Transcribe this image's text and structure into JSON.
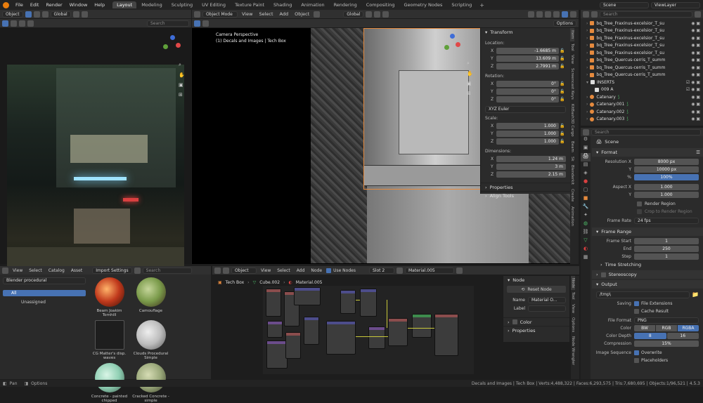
{
  "topbar": {
    "menus": [
      "File",
      "Edit",
      "Render",
      "Window",
      "Help"
    ],
    "workspaces": [
      "Layout",
      "Modeling",
      "Sculpting",
      "UV Editing",
      "Texture Paint",
      "Shading",
      "Animation",
      "Rendering",
      "Compositing",
      "Geometry Nodes",
      "Scripting"
    ],
    "scene": "Scene",
    "view_layer": "ViewLayer"
  },
  "left_viewport": {
    "mode": "Object",
    "orientation": "Global",
    "search_placeholder": "Search"
  },
  "main_viewport": {
    "mode": "Object Mode",
    "menus": [
      "View",
      "Select",
      "Add",
      "Object"
    ],
    "orientation": "Global",
    "options_label": "Options",
    "camera_label": "Camera Perspective",
    "collection_label": "(1) Decals and Images | Tech Box"
  },
  "npanel": {
    "transform_title": "Transform",
    "location_label": "Location:",
    "location": [
      {
        "axis": "X",
        "value": "-1.6685 m"
      },
      {
        "axis": "Y",
        "value": "13.609 m"
      },
      {
        "axis": "Z",
        "value": "2.7991 m"
      }
    ],
    "rotation_label": "Rotation:",
    "rotation": [
      {
        "axis": "X",
        "value": "0°"
      },
      {
        "axis": "Y",
        "value": "0°"
      },
      {
        "axis": "Z",
        "value": "0°"
      }
    ],
    "rotation_mode": "XYZ Euler",
    "scale_label": "Scale:",
    "scale": [
      {
        "axis": "X",
        "value": "1.000"
      },
      {
        "axis": "Y",
        "value": "1.000"
      },
      {
        "axis": "Z",
        "value": "1.000"
      }
    ],
    "dimensions_label": "Dimensions:",
    "dimensions": [
      {
        "axis": "X",
        "value": "1.24 m"
      },
      {
        "axis": "Y",
        "value": "3 m"
      },
      {
        "axis": "Z",
        "value": "2.15 m"
      }
    ],
    "properties_label": "Properties",
    "align_tools_label": "Align Tools",
    "tabs": [
      "Item",
      "Tool",
      "View",
      "Screencast Keys",
      "KitBash3D Cargo",
      "Beam",
      "Sk",
      "Blenderkit",
      "Create",
      "Animation"
    ]
  },
  "outliner": {
    "search_placeholder": "Search",
    "items": [
      {
        "name": "bq_Tree_Fraxinus-excelsior_T_su"
      },
      {
        "name": "bq_Tree_Fraxinus-excelsior_T_su"
      },
      {
        "name": "bq_Tree_Fraxinus-excelsior_T_su"
      },
      {
        "name": "bq_Tree_Fraxinus-excelsior_T_su"
      },
      {
        "name": "bq_Tree_Fraxinus-excelsior_T_su"
      },
      {
        "name": "bq_Tree_Quercus-cerris_T_summ"
      },
      {
        "name": "bq_Tree_Quercus-cerris_T_summ"
      },
      {
        "name": "bq_Tree_Quercus-cerris_T_summ"
      },
      {
        "name": "INSERTS"
      },
      {
        "name": "009 A"
      },
      {
        "name": "Catenary"
      },
      {
        "name": "Catenary.001"
      },
      {
        "name": "Catenary.002"
      },
      {
        "name": "Catenary.003"
      }
    ]
  },
  "properties": {
    "search_placeholder": "Search",
    "scene_name": "Scene",
    "format_label": "Format",
    "resolution_x_label": "Resolution X",
    "resolution_x": "8000 px",
    "resolution_y_label": "Y",
    "resolution_y": "10000 px",
    "percent_label": "%",
    "percent": "100%",
    "aspect_x_label": "Aspect X",
    "aspect_x": "1.000",
    "aspect_y_label": "Y",
    "aspect_y": "1.000",
    "render_region": "Render Region",
    "crop_region": "Crop to Render Region",
    "frame_rate_label": "Frame Rate",
    "frame_rate": "24 fps",
    "frame_range_label": "Frame Range",
    "frame_start_label": "Frame Start",
    "frame_start": "1",
    "end_label": "End",
    "end": "250",
    "step_label": "Step",
    "step": "1",
    "time_stretching": "Time Stretching",
    "stereoscopy": "Stereoscopy",
    "output_label": "Output",
    "output_path": "/tmp\\",
    "saving_label": "Saving",
    "file_extensions": "File Extensions",
    "cache_result": "Cache Result",
    "file_format_label": "File Format",
    "file_format": "PNG",
    "color_label": "Color",
    "color_options": [
      "BW",
      "RGB",
      "RGBA"
    ],
    "color_depth_label": "Color Depth",
    "color_depth_options": [
      "8",
      "16"
    ],
    "compression_label": "Compression",
    "compression": "15%",
    "image_sequence_label": "Image Sequence",
    "overwrite": "Overwrite",
    "placeholders": "Placeholders"
  },
  "asset_browser": {
    "menus": [
      "View",
      "Select",
      "Catalog",
      "Asset"
    ],
    "import_settings": "Import Settings",
    "search_placeholder": "Search",
    "library": "Blender procedural",
    "catalog_all": "All",
    "catalog_unassigned": "Unassigned",
    "assets": [
      {
        "name": "Beam Joakim Tornhill",
        "color": "#c0391c"
      },
      {
        "name": "Camouflage",
        "color": "#7a9a4a"
      },
      {
        "name": "CG Matter's disp. waves",
        "color": "#2a2a2a"
      },
      {
        "name": "Clouds Procedural Simple",
        "color": "#bdbdbd"
      },
      {
        "name": "Concrete - painted chipped",
        "color": "#8fcfb3"
      },
      {
        "name": "Cracked Concrete - simple",
        "color": "#9aa87a"
      }
    ]
  },
  "node_editor": {
    "mode": "Object",
    "menus": [
      "View",
      "Select",
      "Add",
      "Node"
    ],
    "use_nodes": "Use Nodes",
    "slot": "Slot 2",
    "material": "Material.005",
    "breadcrumb": [
      "Tech Box",
      "Cube.002",
      "Material.005"
    ],
    "side_tabs": [
      "Node",
      "Tool",
      "View",
      "Options",
      "Node Wrangler"
    ],
    "node_panel": {
      "title": "Node",
      "reset_node": "Reset Node",
      "name_label": "Name",
      "name_value": "Material O...",
      "label_label": "Label",
      "color_label": "Color",
      "properties_label": "Properties"
    }
  },
  "statusbar": {
    "left": "Pan",
    "options": "Options",
    "info": "Decals and Images | Tech Box | Verts:4,488,322 | Faces:6,293,575 | Tris:7,680,695 | Objects:1/96,521 | 4.5.3"
  }
}
